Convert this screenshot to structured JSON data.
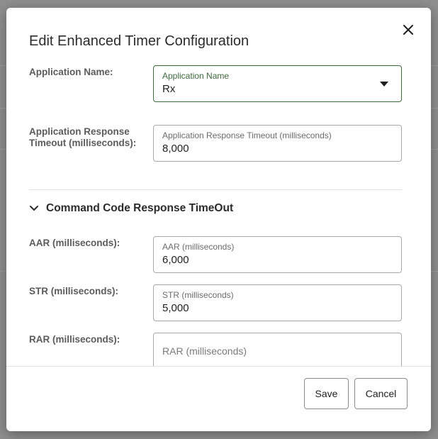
{
  "dialog": {
    "title": "Edit Enhanced Timer Configuration",
    "close_icon": "close-icon"
  },
  "application_name": {
    "label": "Application Name:",
    "field_label": "Application Name",
    "value": "Rx",
    "icon": "dropdown-arrow-icon"
  },
  "app_response_timeout": {
    "label": "Application Response Timeout (milliseconds):",
    "field_label": "Application Response Timeout (milliseconds)",
    "value": "8,000"
  },
  "command_section": {
    "title": "Command Code Response TimeOut",
    "icon": "chevron-down-icon",
    "expanded": true
  },
  "aar": {
    "label": "AAR (milliseconds):",
    "field_label": "AAR (milliseconds)",
    "value": "6,000"
  },
  "str": {
    "label": "STR (milliseconds):",
    "field_label": "STR (milliseconds)",
    "value": "5,000"
  },
  "rar": {
    "label": "RAR (milliseconds):",
    "placeholder": "RAR (milliseconds)",
    "value": ""
  },
  "footer": {
    "save_label": "Save",
    "cancel_label": "Cancel"
  },
  "colors": {
    "focus_border": "#3d6b3c",
    "label_text": "#5b5b5b",
    "backdrop": "#8f8f8f"
  }
}
